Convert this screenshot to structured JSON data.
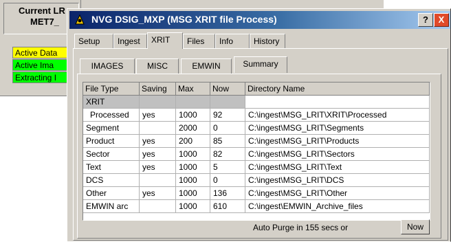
{
  "background_window": {
    "title_line1": "Current LR",
    "title_line2": "MET7_",
    "status_rows": [
      {
        "label": "Active Data",
        "color": "#ffff00"
      },
      {
        "label": "Active Ima",
        "color": "#00ff00"
      },
      {
        "label": "Extracting I",
        "color": "#00ff00"
      }
    ]
  },
  "dialog": {
    "title": "NVG DSIG_MXP   (MSG XRIT file Process)",
    "help_label": "?",
    "close_label": "X",
    "main_tabs": [
      "Setup",
      "Ingest",
      "XRIT",
      "Files",
      "Info",
      "History"
    ],
    "active_main_tab": "XRIT",
    "sub_tabs": [
      "IMAGES",
      "MISC",
      "EMWIN",
      "Summary"
    ],
    "active_sub_tab": "Summary",
    "table": {
      "columns": [
        "File Type",
        "Saving",
        "Max",
        "Now",
        "Directory Name"
      ],
      "rows": [
        [
          "XRIT",
          "",
          "",
          "",
          ""
        ],
        [
          "Processed",
          "yes",
          "1000",
          "92",
          "C:\\ingest\\MSG_LRIT\\XRIT\\Processed"
        ],
        [
          "Segment",
          "",
          "2000",
          "0",
          "C:\\ingest\\MSG_LRIT\\Segments"
        ],
        [
          "Product",
          "yes",
          "200",
          "85",
          "C:\\ingest\\MSG_LRIT\\Products"
        ],
        [
          "Sector",
          "yes",
          "1000",
          "82",
          "C:\\ingest\\MSG_LRIT\\Sectors"
        ],
        [
          "Text",
          "yes",
          "1000",
          "5",
          "C:\\ingest\\MSG_LRIT\\Text"
        ],
        [
          "DCS",
          "",
          "1000",
          "0",
          "C:\\ingest\\MSG_LRIT\\DCS"
        ],
        [
          "Other",
          "yes",
          "1000",
          "136",
          "C:\\ingest\\MSG_LRIT\\Other"
        ],
        [
          "EMWIN arc",
          "",
          "1000",
          "610",
          "C:\\ingest\\EMWIN_Archive_files"
        ]
      ]
    },
    "auto_purge_text": "Auto Purge in 155 secs  or",
    "now_button": "Now"
  }
}
